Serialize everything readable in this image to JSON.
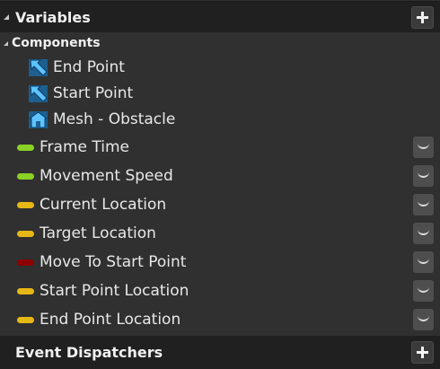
{
  "header": {
    "title": "Variables",
    "add_label": "+"
  },
  "components": {
    "title": "Components",
    "items": [
      {
        "label": "End Point",
        "icon": "scene-arrow-icon"
      },
      {
        "label": "Start Point",
        "icon": "scene-arrow-icon"
      },
      {
        "label": "Mesh - Obstacle",
        "icon": "static-mesh-icon"
      }
    ]
  },
  "variables": [
    {
      "label": "Frame Time",
      "type_color": "#8ad125"
    },
    {
      "label": "Movement Speed",
      "type_color": "#8ad125"
    },
    {
      "label": "Current Location",
      "type_color": "#e7b815"
    },
    {
      "label": "Target Location",
      "type_color": "#e7b815"
    },
    {
      "label": "Move To Start Point",
      "type_color": "#8b0000"
    },
    {
      "label": "Start Point Location",
      "type_color": "#e7b815"
    },
    {
      "label": "End Point Location",
      "type_color": "#e7b815"
    }
  ],
  "footer": {
    "title": "Event Dispatchers",
    "add_label": "+"
  }
}
